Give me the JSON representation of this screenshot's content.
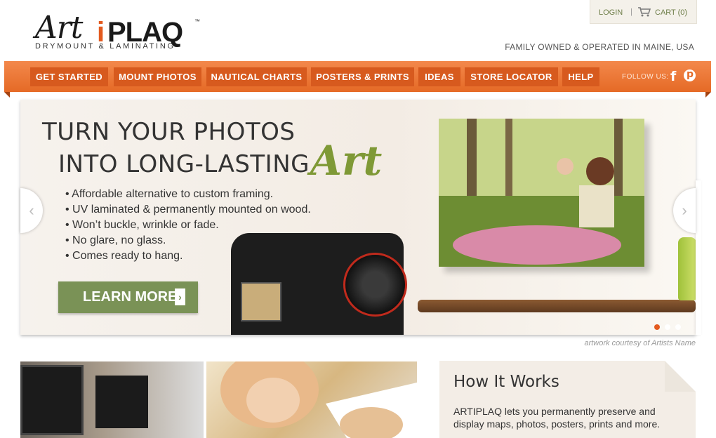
{
  "brand": {
    "art": "Art",
    "i": "i",
    "plaq": "PLAQ",
    "tm": "™",
    "subtitle": "DRYMOUNT & LAMINATING",
    "accent": "#e35a1f"
  },
  "topbar": {
    "login": "LOGIN",
    "separator": "|",
    "cart": "CART (0)",
    "cart_icon": "cart-icon"
  },
  "tagline": "FAMILY OWNED & OPERATED IN MAINE, USA",
  "nav": {
    "items": [
      {
        "label": "GET STARTED"
      },
      {
        "label": "MOUNT PHOTOS"
      },
      {
        "label": "NAUTICAL CHARTS"
      },
      {
        "label": "POSTERS & PRINTS"
      },
      {
        "label": "IDEAS"
      },
      {
        "label": "STORE LOCATOR"
      },
      {
        "label": "HELP"
      }
    ],
    "follow_label": "FOLLOW US:",
    "facebook": "f",
    "pinterest": "p",
    "colors": {
      "bar": "#ee7a38",
      "button": "#d75a1e"
    }
  },
  "hero": {
    "line1": "TURN YOUR PHOTOS",
    "line2": "INTO LONG-LASTING",
    "art_word": "Art",
    "bullets": [
      "• Affordable alternative to custom framing.",
      "• UV laminated & permanently mounted on wood.",
      "• Won’t buckle, wrinkle or fade.",
      "• No glare, no glass.",
      "• Comes ready to hang."
    ],
    "cta": "LEARN MORE",
    "cta_arrow": "›",
    "prev_arrow": "‹",
    "next_arrow": "›",
    "slides": {
      "count": 3,
      "active": 1
    },
    "credit": "artwork courtesy of Artists Name"
  },
  "how": {
    "title": "How It Works",
    "text": "ARTIPLAQ lets you permanently preserve and display maps, photos, posters, prints and more."
  }
}
